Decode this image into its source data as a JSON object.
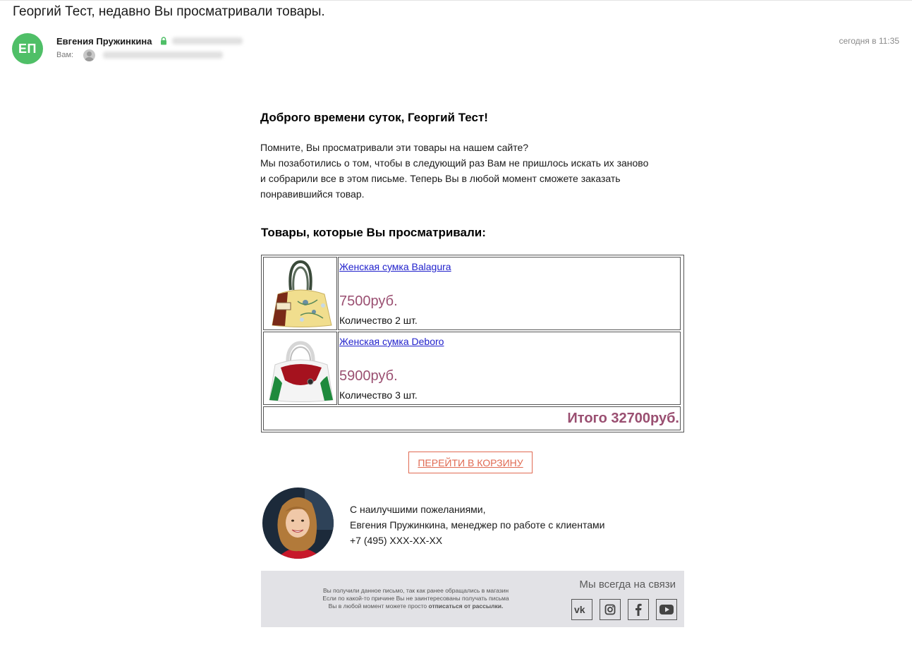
{
  "email": {
    "subject": "Георгий Тест, недавно Вы просматривали товары.",
    "sender_initials": "ЕП",
    "sender_name": "Евгения Пружинкина",
    "to_label": "Вам:",
    "date": "сегодня в 11:35"
  },
  "body": {
    "greeting": "Доброго времени суток, Георгий Тест!",
    "intro_lines": [
      "Помните, Вы просматривали эти товары на нашем сайте?",
      "Мы позаботились о том, чтобы в следующий раз Вам не пришлось искать их заново",
      "и собрарили все в этом письме. Теперь Вы в любой момент сможете заказать",
      "понравившийся товар."
    ],
    "products_heading": "Товары, которые Вы просматривали:",
    "products": [
      {
        "name": "Женская сумка Balagura",
        "price": "7500руб.",
        "quantity": "Количество 2 шт."
      },
      {
        "name": "Женская сумка Deboro",
        "price": "5900руб.",
        "quantity": "Количество 3 шт."
      }
    ],
    "total": "Итого 32700руб.",
    "cart_button": "ПЕРЕЙТИ В КОРЗИНУ",
    "signature_lines": [
      "С наилучшими пожеланиями,",
      "Евгения Пружинкина, менеджер по работе с клиентами",
      "+7 (495) XXX-XX-XX"
    ]
  },
  "footer": {
    "notice_line1": "Вы получили данное письмо, так как ранее обращались в магазин",
    "notice_line2": "Если по какой-то причине Вы не заинтересованы получать письма",
    "notice_line3_prefix": "Вы в любой момент можете просто ",
    "unsubscribe_link": "отписаться от рассылки.",
    "contact_title": "Мы всегда на связи",
    "social_icons": [
      "vk-icon",
      "instagram-icon",
      "facebook-icon",
      "youtube-icon"
    ]
  },
  "colors": {
    "avatar_bg": "#4fbf67",
    "price": "#9a4f71",
    "link": "#2222cc",
    "button": "#e06a52",
    "footer_bg": "#e2e2e6"
  }
}
